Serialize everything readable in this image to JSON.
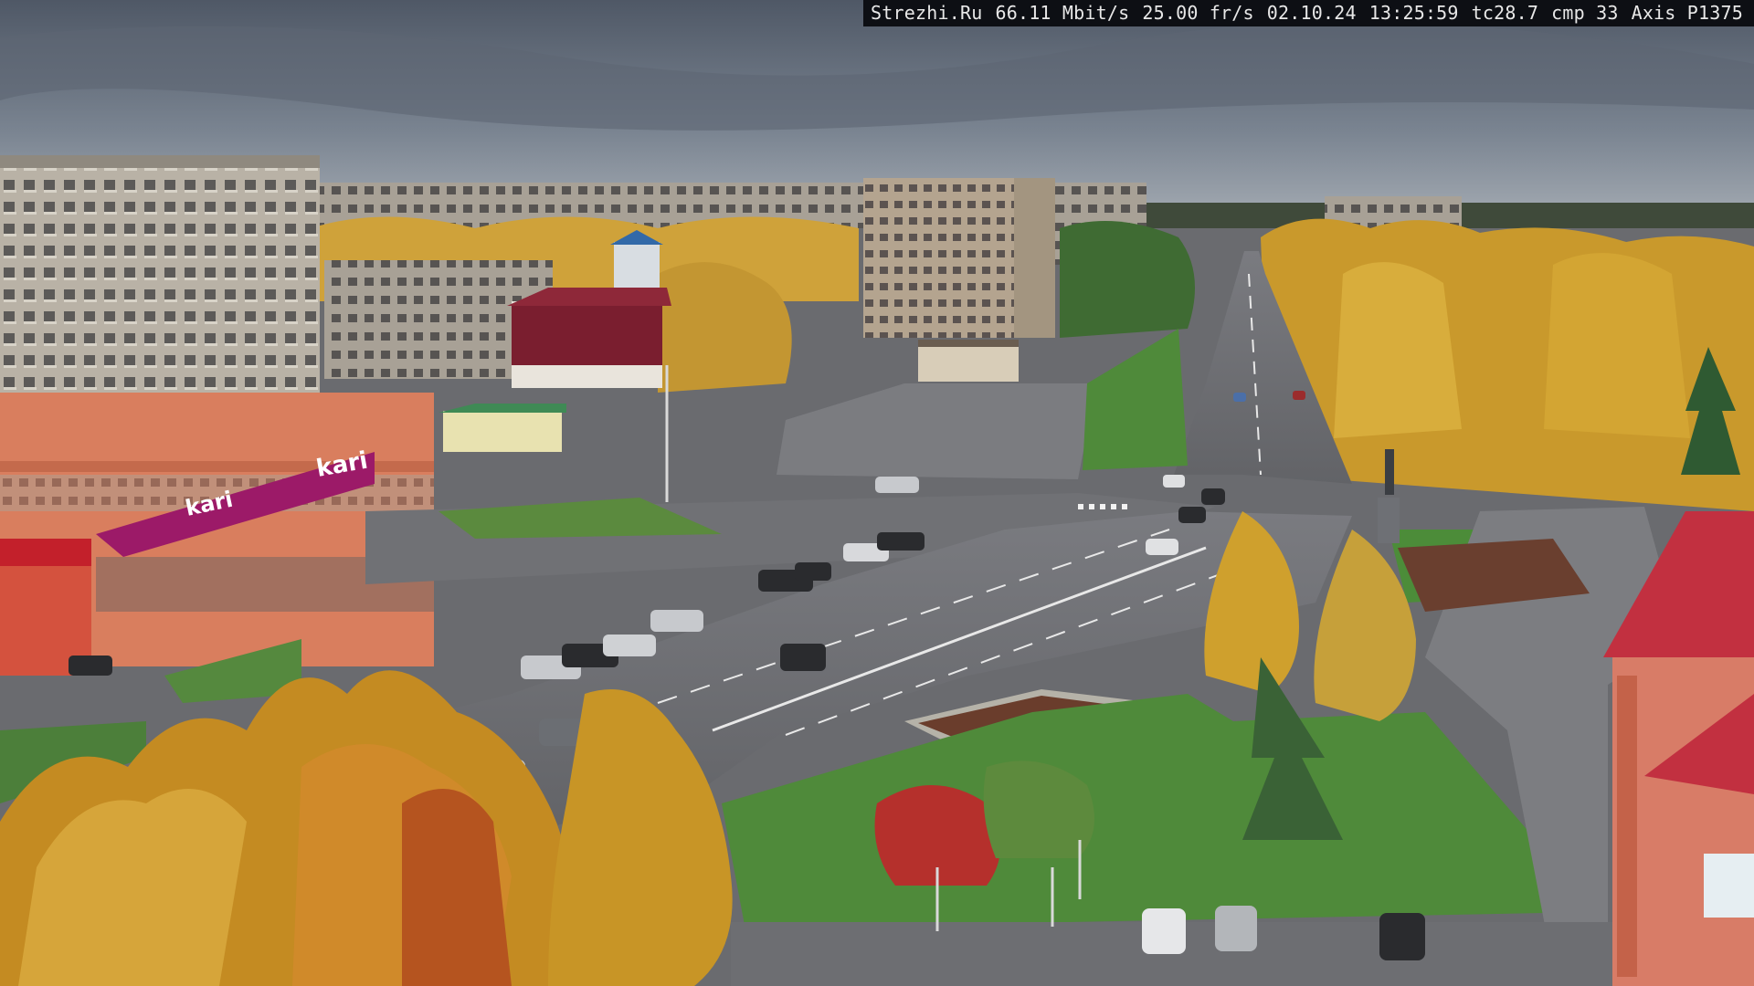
{
  "overlay": {
    "source": "Strezhi.Ru",
    "bitrate": "66.11 Mbit/s",
    "framerate": "25.00 fr/s",
    "date": "02.10.24",
    "time": "13:25:59",
    "tc": "tc28.7",
    "cmp": "cmp 33",
    "camera_model": "Axis P1375"
  },
  "signs": {
    "store_brand": "kari",
    "store_brand_lower": "kari"
  },
  "scene": {
    "season": "autumn",
    "sky_color": "#6f7a87",
    "foliage_color": "#d4a321",
    "asphalt_color": "#6d6e72",
    "grass_color": "#4f8a3a",
    "brand_color": "#9c1a68"
  }
}
